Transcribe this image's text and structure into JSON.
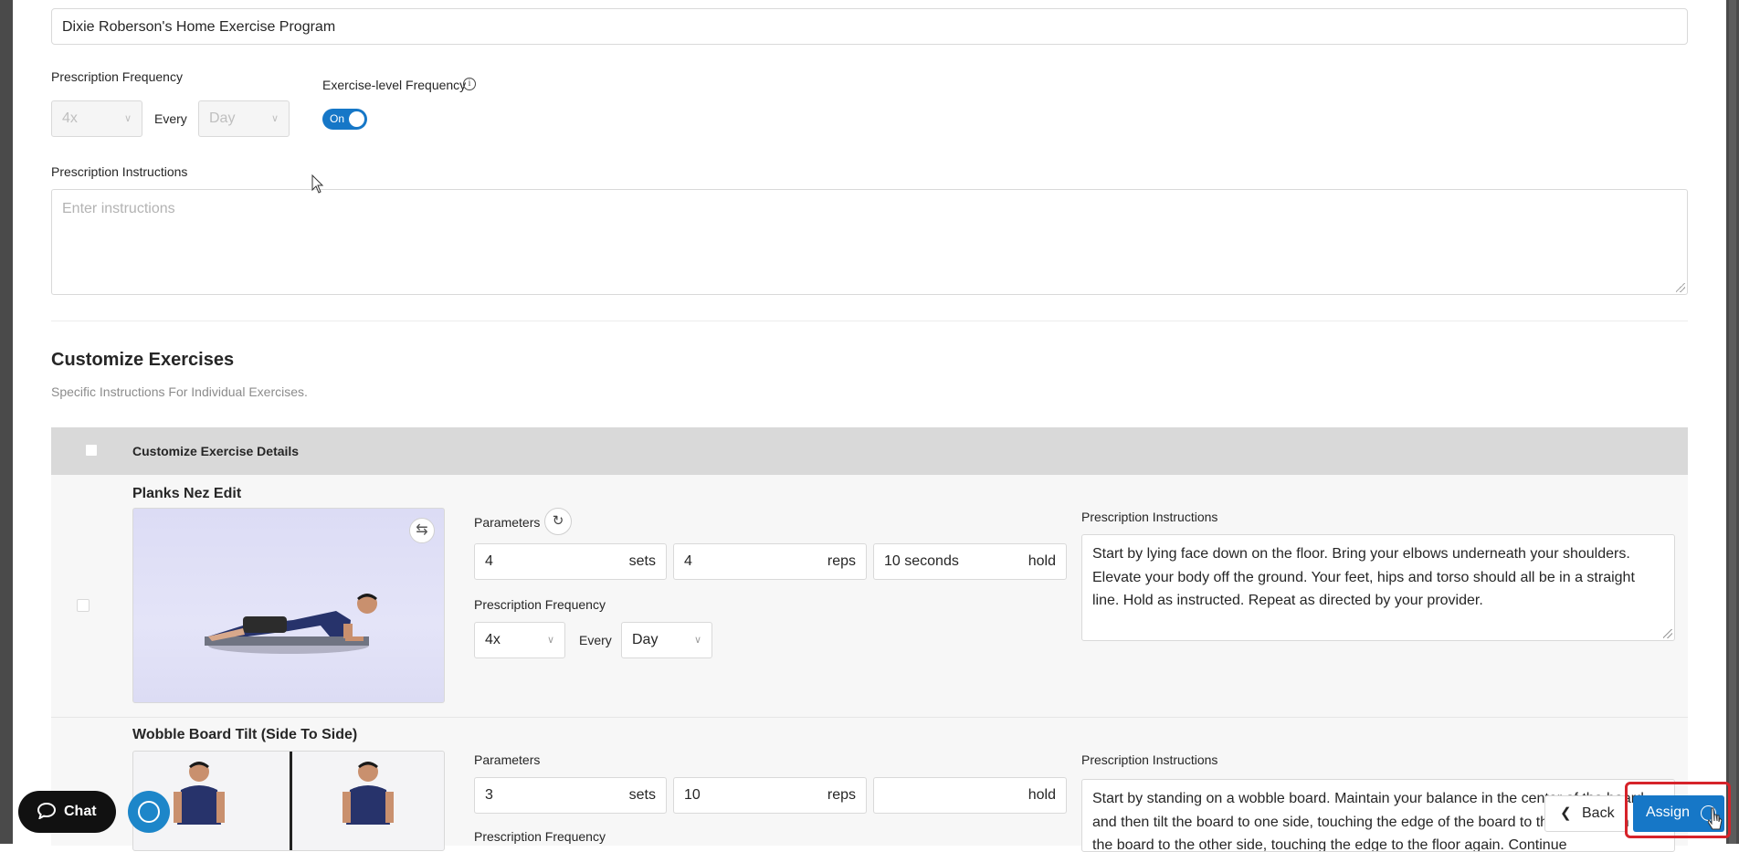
{
  "program": {
    "title_value": "Dixie Roberson's Home Exercise Program"
  },
  "prescription": {
    "frequency_label": "Prescription Frequency",
    "frequency_count": "4x",
    "every_label": "Every",
    "frequency_period": "Day",
    "exercise_level_label": "Exercise-level Frequency",
    "toggle_text": "On",
    "instructions_label": "Prescription Instructions",
    "instructions_placeholder": "Enter instructions"
  },
  "customize": {
    "title": "Customize Exercises",
    "subtitle": "Specific Instructions For Individual Exercises.",
    "header_label": "Customize Exercise Details"
  },
  "exercises": [
    {
      "name": "Planks Nez Edit",
      "parameters_label": "Parameters",
      "sets": "4",
      "sets_unit": "sets",
      "reps": "4",
      "reps_unit": "reps",
      "hold": "10 seconds",
      "hold_unit": "hold",
      "frequency_label": "Prescription Frequency",
      "frequency_count": "4x",
      "every_label": "Every",
      "frequency_period": "Day",
      "instructions_label": "Prescription Instructions",
      "instructions": "Start by lying face down on the floor. Bring your elbows underneath your shoulders. Elevate your body off the ground. Your feet, hips and torso should all be in a straight line. Hold as instructed. Repeat as directed by your provider."
    },
    {
      "name": "Wobble Board Tilt (Side To Side)",
      "parameters_label": "Parameters",
      "sets": "3",
      "sets_unit": "sets",
      "reps": "10",
      "reps_unit": "reps",
      "hold": "",
      "hold_unit": "hold",
      "frequency_label": "Prescription Frequency",
      "instructions_label": "Prescription Instructions",
      "instructions": "Start by standing on a wobble board. Maintain your balance in the center of the board and then tilt the board to one side, touching the edge of the board to the floor. Then tilt the board to the other side, touching the edge to the floor again. Continue"
    }
  ],
  "footer": {
    "chat_label": "Chat",
    "back_label": "Back",
    "assign_label": "Assign"
  },
  "colors": {
    "primary": "#1677c7",
    "highlight": "#d6232a",
    "header_bg": "#d9d9d9"
  }
}
